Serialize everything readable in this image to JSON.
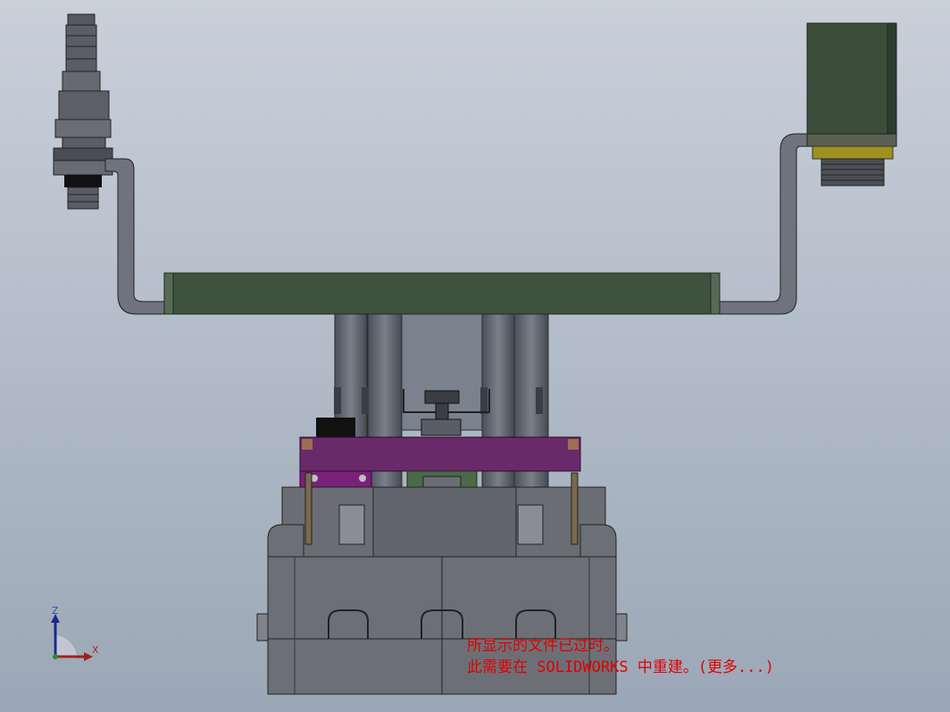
{
  "viewport": {
    "background_top": "#c9d0da",
    "background_bottom": "#9ba7b6"
  },
  "warning": {
    "line1": "所显示的文件已过时。",
    "line2": "此需要在 SOLIDWORKS 中重建。(更多...)",
    "color": "#e00000"
  },
  "triad": {
    "z_label": "Z",
    "x_label": "X"
  },
  "colors": {
    "plate_green": "#3e523e",
    "bracket_gray": "#707480",
    "motor_green": "#3c4e3a",
    "purple": "#6a2a6a",
    "base_gray": "#6c7076",
    "gold": "#a09020"
  }
}
